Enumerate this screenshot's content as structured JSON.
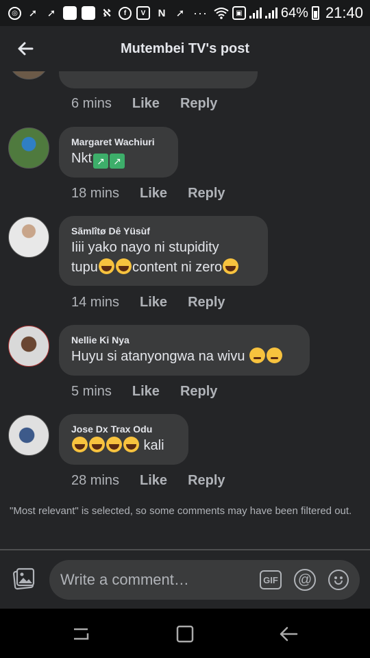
{
  "status_bar": {
    "battery": "64%",
    "time": "21:40"
  },
  "header": {
    "title": "Mutembei TV's post"
  },
  "comments": [
    {
      "name": "",
      "text": "",
      "time": "6 mins",
      "like": "Like",
      "reply": "Reply"
    },
    {
      "name": "Margaret Wachiuri",
      "text": "Nkt",
      "time": "18 mins",
      "like": "Like",
      "reply": "Reply"
    },
    {
      "name": "Sãmlîtø Dê Yüsùf",
      "line1": "Iiii yako nayo ni stupidity",
      "line2a": "tupu",
      "line2b": "content ni zero",
      "time": "14 mins",
      "like": "Like",
      "reply": "Reply"
    },
    {
      "name": "Nellie Ki Nya",
      "text": "Huyu si atanyongwa na wivu ",
      "time": "5 mins",
      "like": "Like",
      "reply": "Reply"
    },
    {
      "name": "Jose Dx Trax Odu",
      "text": " kali",
      "time": "28 mins",
      "like": "Like",
      "reply": "Reply"
    }
  ],
  "filter_note": "\"Most relevant\" is selected, so some comments may have been filtered out.",
  "composer": {
    "placeholder": "Write a comment…",
    "gif_label": "GIF",
    "at_label": "@"
  },
  "colors": {
    "background": "#242527",
    "bubble": "#3a3b3c",
    "text_primary": "#e4e6eb",
    "text_secondary": "#b0b3b8"
  }
}
